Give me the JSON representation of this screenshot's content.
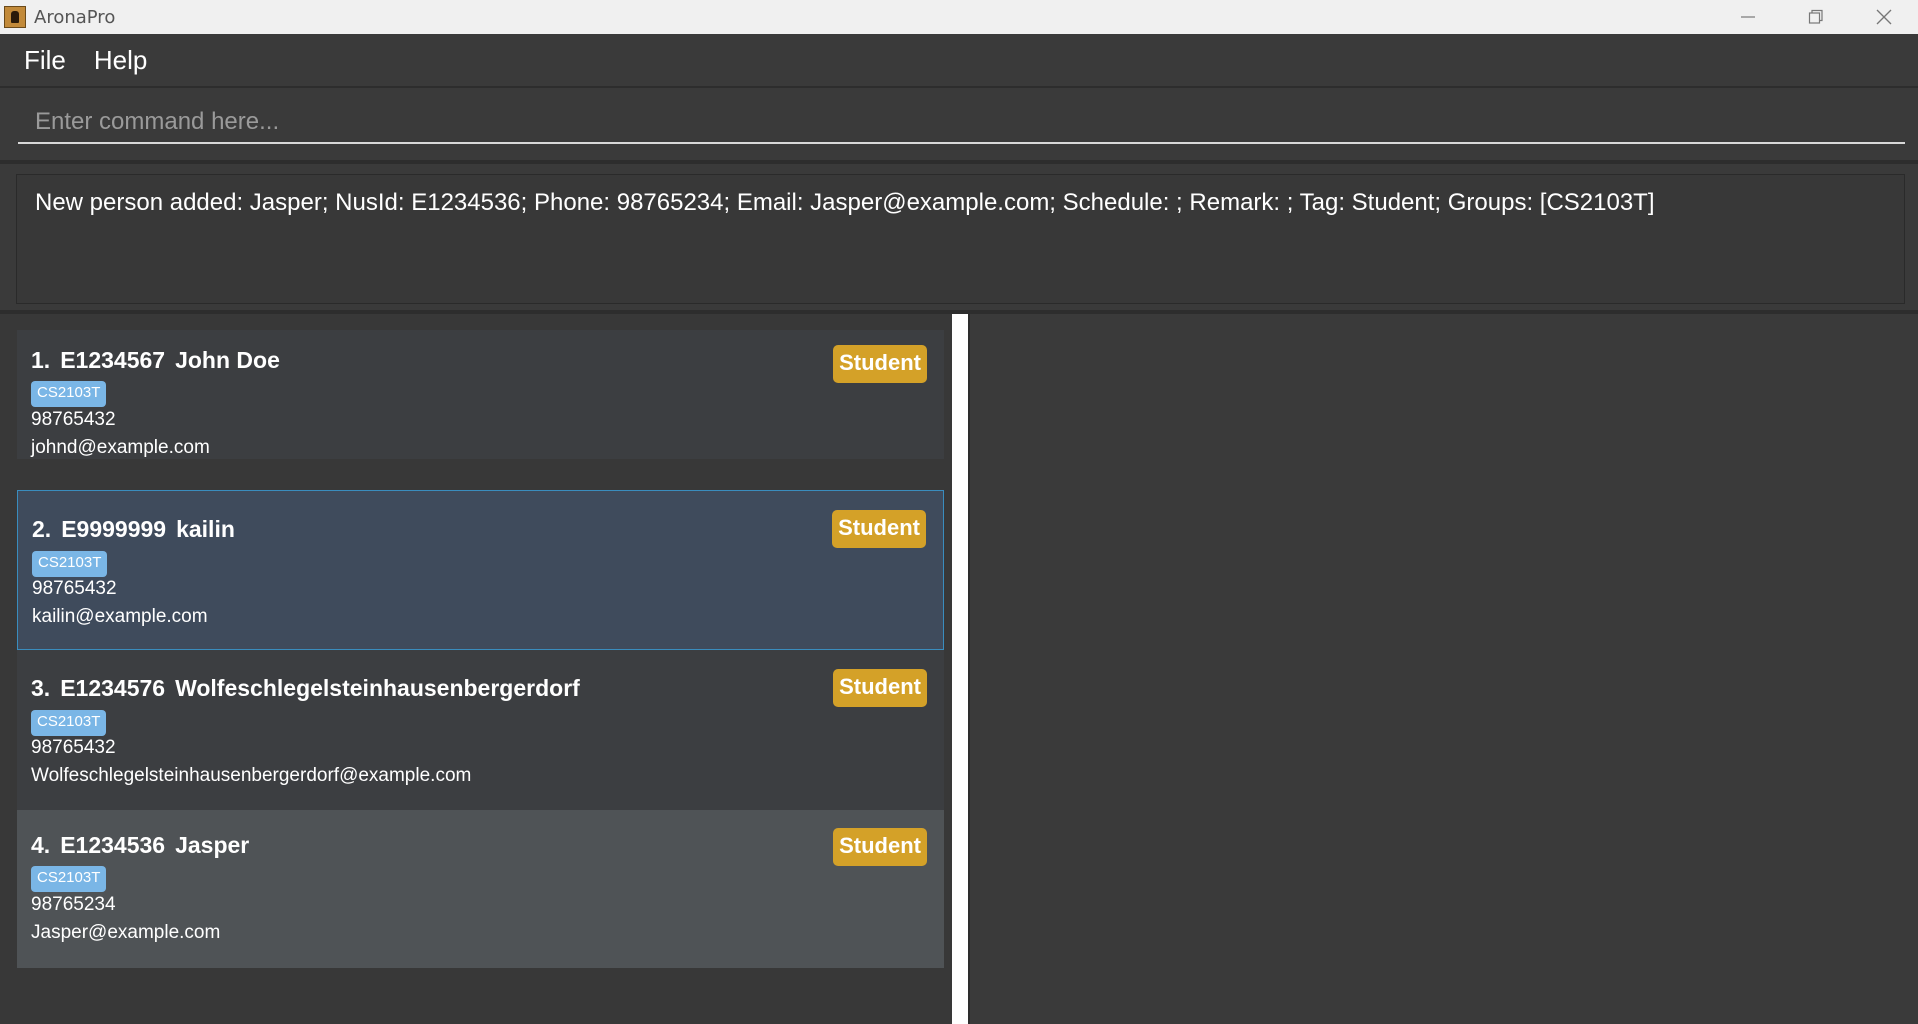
{
  "window": {
    "title": "AronaPro",
    "controls": {
      "minimize": "—",
      "restore": "❐",
      "close": "✕"
    }
  },
  "menu": {
    "items": [
      {
        "label": "File"
      },
      {
        "label": "Help"
      }
    ]
  },
  "command": {
    "placeholder": "Enter command here...",
    "value": ""
  },
  "result": {
    "text": "New person added: Jasper; NusId: E1234536; Phone: 98765234; Email: Jasper@example.com; Schedule: ; Remark: ; Tag: Student; Groups: [CS2103T]"
  },
  "persons": [
    {
      "index": "1.",
      "nusid": "E1234567",
      "name": "John Doe",
      "group": "CS2103T",
      "phone": "98765432",
      "email": "johnd@example.com",
      "tag": "Student"
    },
    {
      "index": "2.",
      "nusid": "E9999999",
      "name": "kailin",
      "group": "CS2103T",
      "phone": "98765432",
      "email": "kailin@example.com",
      "tag": "Student"
    },
    {
      "index": "3.",
      "nusid": "E1234576",
      "name": "Wolfeschlegelsteinhausenbergerdorf",
      "group": "CS2103T",
      "phone": "98765432",
      "email": "Wolfeschlegelsteinhausenbergerdorf@example.com",
      "tag": "Student"
    },
    {
      "index": "4.",
      "nusid": "E1234536",
      "name": "Jasper",
      "group": "CS2103T",
      "phone": "98765234",
      "email": "Jasper@example.com",
      "tag": "Student"
    }
  ],
  "colors": {
    "tag": "#d4a128",
    "group": "#7ab6e6",
    "selected_border": "#3a8dbe"
  }
}
